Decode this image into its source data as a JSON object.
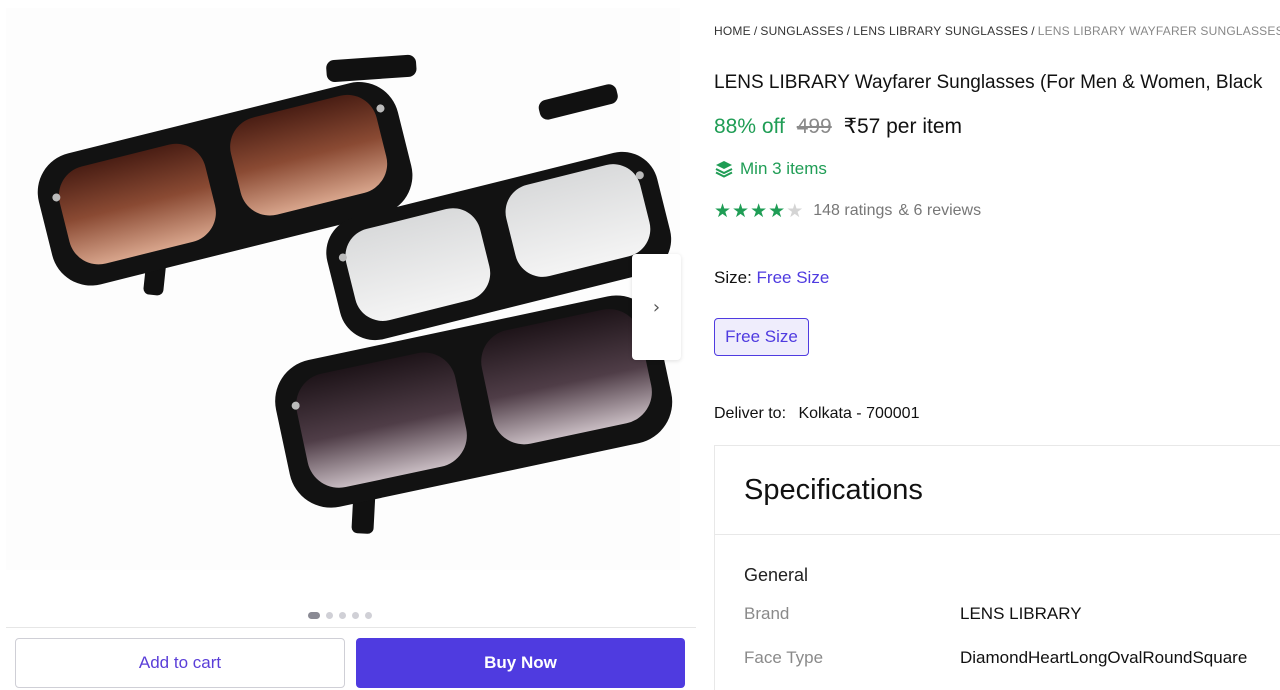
{
  "breadcrumb": [
    {
      "label": "HOME"
    },
    {
      "label": "SUNGLASSES"
    },
    {
      "label": "LENS LIBRARY SUNGLASSES"
    },
    {
      "label": "LENS LIBRARY WAYFARER SUNGLASSES (F"
    }
  ],
  "product": {
    "title": "LENS LIBRARY Wayfarer Sunglasses (For Men & Women, Black",
    "discount": "88% off",
    "mrp": "499",
    "price": "₹57 per item",
    "min_items": "Min 3 items",
    "rating_stars": 4,
    "ratings_text": "148 ratings",
    "reviews_text": "& 6 reviews"
  },
  "size": {
    "label": "Size:",
    "value": "Free Size",
    "options": [
      "Free Size"
    ]
  },
  "delivery": {
    "label": "Deliver to:",
    "location": "Kolkata - 700001"
  },
  "gallery": {
    "next_arrow": "›",
    "image_count": 5,
    "active_index": 0
  },
  "actions": {
    "add_to_cart": "Add to cart",
    "buy_now": "Buy Now"
  },
  "specifications": {
    "title": "Specifications",
    "group": "General",
    "rows": [
      {
        "key": "Brand",
        "value": "LENS LIBRARY"
      },
      {
        "key": "Face Type",
        "value": "DiamondHeartLongOvalRoundSquare"
      }
    ]
  },
  "colors": {
    "accent": "#4f3be0",
    "success": "#1f9d55"
  }
}
